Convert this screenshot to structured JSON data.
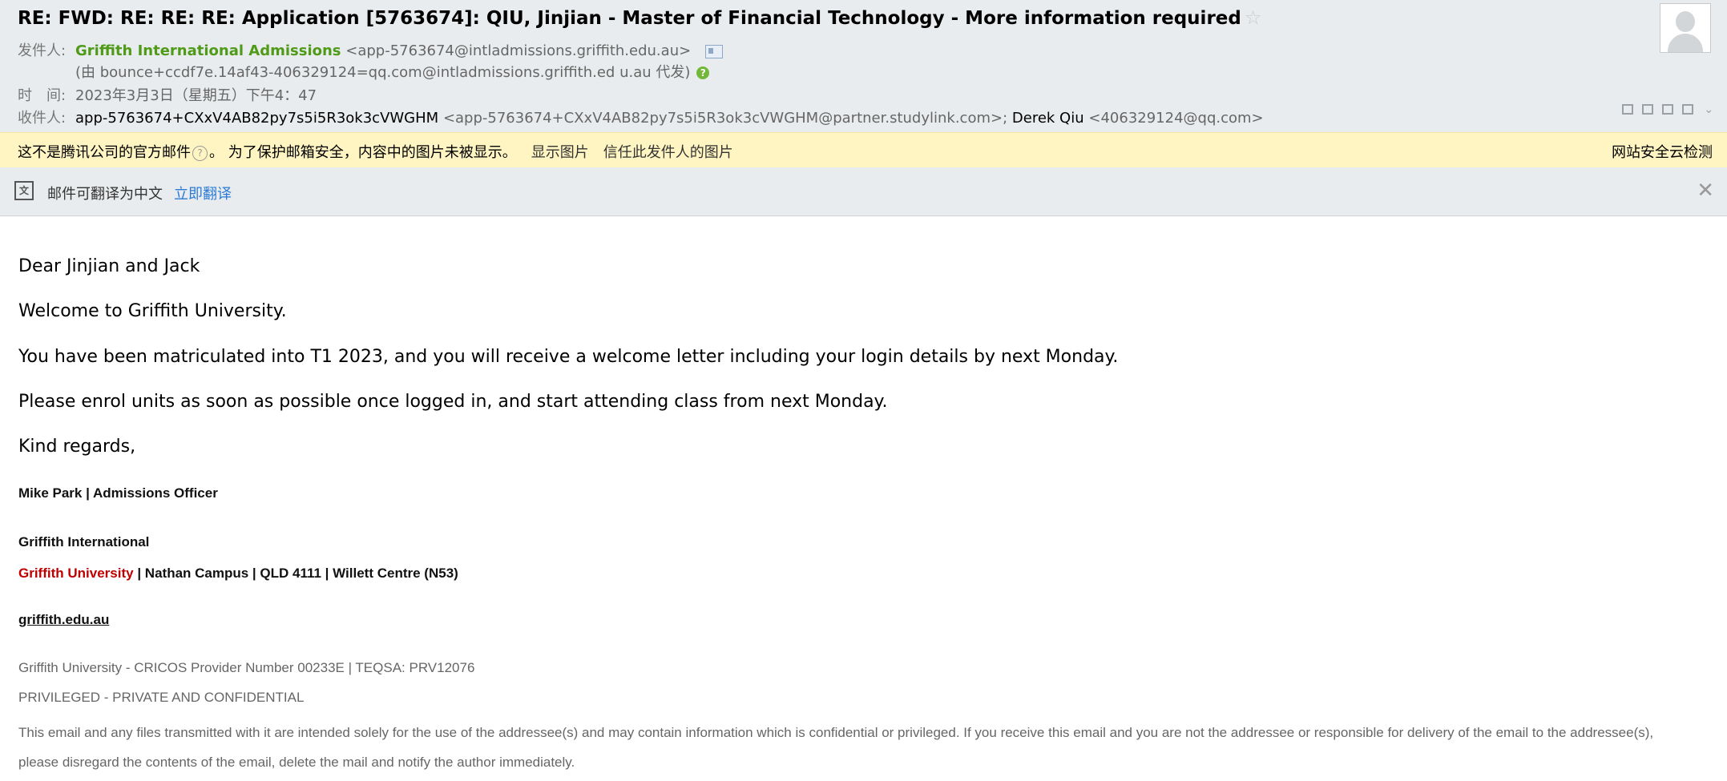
{
  "email": {
    "subject": "RE: FWD: RE: RE: RE: Application [5763674]: QIU, Jinjian - Master of Financial Technology - More information required",
    "star": "☆",
    "from_label": "发件人:",
    "from_name": "Griffith International Admissions",
    "from_email": "<app-5763674@intladmissions.griffith.edu.au>",
    "via_text": "(由 bounce+ccdf7e.14af43-406329124=qq.com@intladmissions.griffith.ed u.au 代发)",
    "time_label": "时　间:",
    "time_value": "2023年3月3日（星期五）下午4：47",
    "to_label": "收件人:",
    "to_name1": "app-5763674+CXxV4AB82py7s5i5R3ok3cVWGHM",
    "to_email1": "<app-5763674+CXxV4AB82py7s5i5R3ok3cVWGHM@partner.studylink.com>;",
    "to_name2": "Derek Qiu",
    "to_email2": "<406329124@qq.com>"
  },
  "warning": {
    "text1": "这不是腾讯公司的官方邮件",
    "qmark": "?",
    "text2": "。 为了保护邮箱安全，内容中的图片未被显示。",
    "show_images": "显示图片",
    "trust_sender": "信任此发件人的图片",
    "right": "网站安全云检测"
  },
  "translate": {
    "icon_text": "文",
    "text": "邮件可翻译为中文",
    "link": "立即翻译",
    "close": "✕"
  },
  "body": {
    "greeting": "Dear Jinjian and Jack",
    "welcome": "Welcome to Griffith University.",
    "para1": "You have been matriculated into T1 2023, and you will receive a welcome letter including your login details by next Monday.",
    "para2": "Please enrol units as soon as possible once logged in, and start attending class from next Monday.",
    "regards": "Kind regards,",
    "sig_name": "Mike Park | Admissions Officer",
    "sig_org": "Griffith International",
    "sig_uni": "Griffith University",
    "sig_campus": " | Nathan Campus | QLD 4111 | Willett Centre (N53)",
    "sig_web": "griffith.edu.au",
    "footer1": "Griffith University - CRICOS Provider Number 00233E | TEQSA: PRV12076",
    "footer2": "PRIVILEGED - PRIVATE AND CONFIDENTIAL",
    "footer3": "This email and any files transmitted with it are intended solely for the use of the addressee(s) and may contain information which is confidential or privileged.  If you receive this email and you are not the addressee or responsible for delivery of the email to the addressee(s), please disregard the contents of the email, delete the mail and notify the author immediately."
  }
}
